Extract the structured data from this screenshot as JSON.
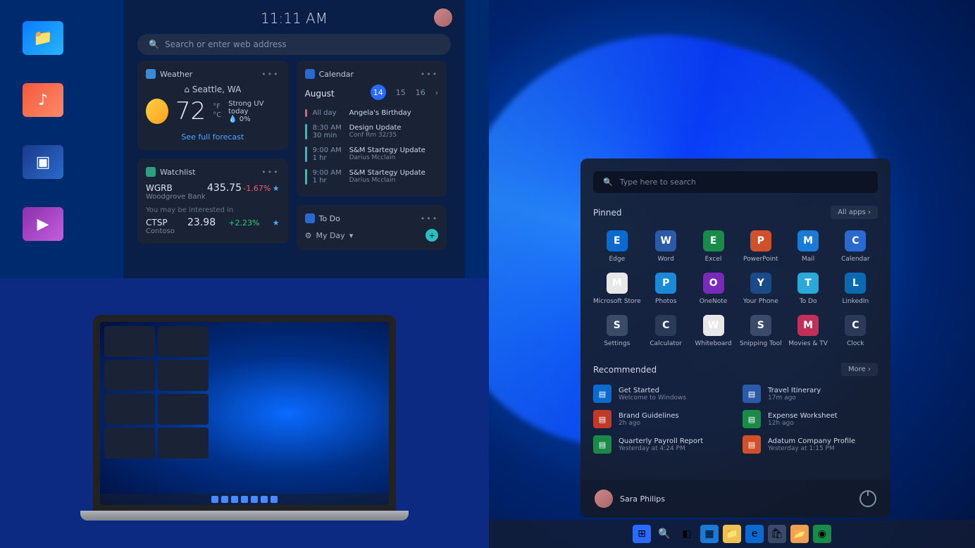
{
  "desktopIcons": [
    {
      "name": "files-folder-icon",
      "glyph": "📁",
      "cls": "blue"
    },
    {
      "name": "music-folder-icon",
      "glyph": "♪",
      "cls": "orange"
    },
    {
      "name": "pictures-folder-icon",
      "glyph": "▣",
      "cls": "navy"
    },
    {
      "name": "videos-folder-icon",
      "glyph": "▶",
      "cls": "purple"
    }
  ],
  "widgets": {
    "time": "11:11 AM",
    "searchPlaceholder": "Search or enter web address",
    "weather": {
      "title": "Weather",
      "city": "⌂ Seattle, WA",
      "temp": "72",
      "unitF": "°F",
      "unitC": "°C",
      "uv": "Strong UV today",
      "precip": "💧 0%",
      "link": "See full forecast"
    },
    "watchlist": {
      "title": "Watchlist",
      "items": [
        {
          "sym": "WGRB",
          "name": "Woodgrove Bank",
          "price": "435.75",
          "chg": "-1.67%",
          "dir": "neg"
        },
        {
          "sym": "CTSP",
          "name": "Contoso",
          "price": "23.98",
          "chg": "+2.23%",
          "dir": "pos"
        }
      ],
      "hint": "You may be interested in"
    },
    "calendar": {
      "title": "Calendar",
      "month": "August",
      "dates": [
        "14",
        "15",
        "16"
      ],
      "events": [
        {
          "bar": "r",
          "time": "All day",
          "title": "Angela's Birthday",
          "sub": ""
        },
        {
          "bar": "t",
          "time": "8:30 AM",
          "dur": "30 min",
          "title": "Design Update",
          "sub": "Conf Rm 32/35"
        },
        {
          "bar": "t",
          "time": "9:00 AM",
          "dur": "1 hr",
          "title": "S&M Startegy Update",
          "sub": "Darius Mcclain"
        },
        {
          "bar": "t",
          "time": "9:00 AM",
          "dur": "1 hr",
          "title": "S&M Startegy Update",
          "sub": "Darius Mcclain"
        }
      ]
    },
    "todo": {
      "title": "To Do",
      "row": "My Day"
    }
  },
  "start": {
    "searchPlaceholder": "Type here to search",
    "pinnedLabel": "Pinned",
    "allApps": "All apps  ›",
    "pinned": [
      {
        "name": "Edge",
        "bg": "#0b6ad0"
      },
      {
        "name": "Word",
        "bg": "#2a5aa8"
      },
      {
        "name": "Excel",
        "bg": "#1a8a48"
      },
      {
        "name": "PowerPoint",
        "bg": "#d0502a"
      },
      {
        "name": "Mail",
        "bg": "#1a7ad8"
      },
      {
        "name": "Calendar",
        "bg": "#2a6ad0"
      },
      {
        "name": "Microsoft Store",
        "bg": "#e8e8e8"
      },
      {
        "name": "Photos",
        "bg": "#1a8ad8"
      },
      {
        "name": "OneNote",
        "bg": "#7a2ab8"
      },
      {
        "name": "Your Phone",
        "bg": "#1a4a88"
      },
      {
        "name": "To Do",
        "bg": "#2aa8d8"
      },
      {
        "name": "LinkedIn",
        "bg": "#0a6ab0"
      },
      {
        "name": "Settings",
        "bg": "#3a4a68"
      },
      {
        "name": "Calculator",
        "bg": "#2a3a58"
      },
      {
        "name": "Whiteboard",
        "bg": "#e8e8e8"
      },
      {
        "name": "Snipping Tool",
        "bg": "#3a4a68"
      },
      {
        "name": "Movies & TV",
        "bg": "#c0305a"
      },
      {
        "name": "Clock",
        "bg": "#2a3a58"
      }
    ],
    "recLabel": "Recommended",
    "more": "More  ›",
    "recommended": [
      {
        "title": "Get Started",
        "sub": "Welcome to Windows",
        "bg": "#0a6ad0"
      },
      {
        "title": "Travel Itinerary",
        "sub": "17m ago",
        "bg": "#2a5aa8"
      },
      {
        "title": "Brand Guidelines",
        "sub": "2h ago",
        "bg": "#c03a2a"
      },
      {
        "title": "Expense Worksheet",
        "sub": "12h ago",
        "bg": "#1a8a48"
      },
      {
        "title": "Quarterly Payroll Report",
        "sub": "Yesterday at 4:24 PM",
        "bg": "#1a8a48"
      },
      {
        "title": "Adatum Company Profile",
        "sub": "Yesterday at 1:15 PM",
        "bg": "#d0502a"
      }
    ],
    "user": "Sara Philips"
  },
  "taskbar": [
    {
      "name": "start-icon",
      "bg": "#2a6aff",
      "g": "⊞"
    },
    {
      "name": "search-icon",
      "bg": "",
      "g": "🔍"
    },
    {
      "name": "taskview-icon",
      "bg": "",
      "g": "◧"
    },
    {
      "name": "widgets-icon",
      "bg": "#1a7ad8",
      "g": "▦"
    },
    {
      "name": "explorer-icon",
      "bg": "#f0c050",
      "g": "📁"
    },
    {
      "name": "edge-icon",
      "bg": "#0b6ad0",
      "g": "e"
    },
    {
      "name": "store-icon",
      "bg": "#3a4a68",
      "g": "🛍"
    },
    {
      "name": "folder-icon",
      "bg": "#f0a050",
      "g": "📂"
    },
    {
      "name": "xbox-icon",
      "bg": "#1a8a48",
      "g": "◉"
    }
  ]
}
